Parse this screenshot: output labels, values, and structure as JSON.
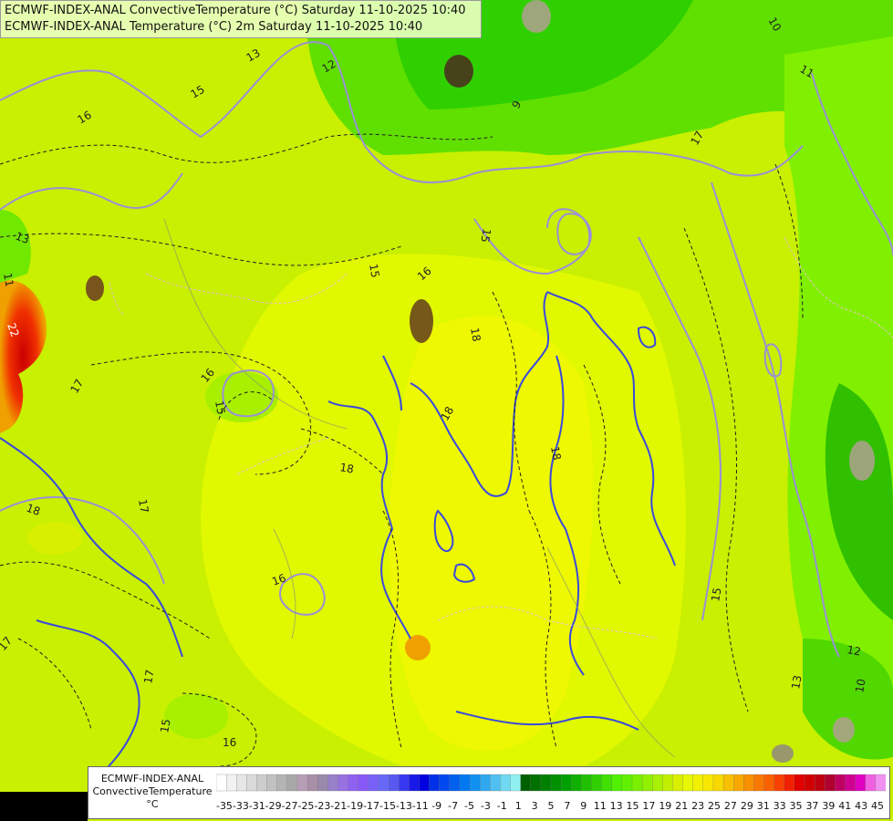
{
  "title": {
    "line1": "ECMWF-INDEX-ANAL ConvectiveTemperature (°C) Saturday 11-10-2025 10:40",
    "line2": "ECMWF-INDEX-ANAL Temperature (°C) 2m Saturday 11-10-2025 10:40"
  },
  "legend": {
    "line1": "ECMWF-INDEX-ANAL",
    "line2": "ConvectiveTemperature",
    "unit": "°C",
    "tick_labels": [
      "-35",
      "-33",
      "-31",
      "-29",
      "-27",
      "-25",
      "-23",
      "-21",
      "-19",
      "-17",
      "-15",
      "-13",
      "-11",
      "-9",
      "-7",
      "-5",
      "-3",
      "-1",
      "1",
      "3",
      "5",
      "7",
      "9",
      "11",
      "13",
      "15",
      "17",
      "19",
      "21",
      "23",
      "25",
      "27",
      "29",
      "31",
      "33",
      "35",
      "37",
      "39",
      "41",
      "43",
      "45"
    ],
    "colors": [
      "#ffffff",
      "#f2f2f2",
      "#e6e6e6",
      "#dadada",
      "#cdcdcd",
      "#c1c1c1",
      "#b4b4b4",
      "#a8a8a8",
      "#b79eb7",
      "#a890a8",
      "#9a8aaa",
      "#9880c8",
      "#9870e0",
      "#9060f0",
      "#8858f8",
      "#7860f8",
      "#6868f8",
      "#5858f0",
      "#3838f0",
      "#1818e8",
      "#0000e0",
      "#0030e8",
      "#0048f0",
      "#0060f0",
      "#0078f0",
      "#1090f0",
      "#30a8f0",
      "#50c0f0",
      "#70d8f0",
      "#90f0f0",
      "#006000",
      "#007000",
      "#008000",
      "#009000",
      "#00a000",
      "#10b000",
      "#20c000",
      "#30d000",
      "#40e000",
      "#50f000",
      "#60f000",
      "#78f000",
      "#90f000",
      "#a8f000",
      "#c0f000",
      "#d8f000",
      "#e8f800",
      "#f0f000",
      "#f8e800",
      "#f8d800",
      "#f8c000",
      "#f8a800",
      "#f89000",
      "#f87800",
      "#f86000",
      "#f84000",
      "#f02000",
      "#e00000",
      "#d00000",
      "#c00010",
      "#b00030",
      "#c00060",
      "#d00090",
      "#e000c0",
      "#f060e0",
      "#f090f0"
    ]
  },
  "map": {
    "contour_labels": [
      "13",
      "12",
      "10",
      "11",
      "9",
      "15",
      "16",
      "13",
      "11",
      "15",
      "16",
      "15",
      "18",
      "17",
      "15",
      "16",
      "18",
      "17",
      "18",
      "16",
      "17",
      "15",
      "16",
      "17",
      "18",
      "15",
      "13",
      "12",
      "10",
      "18",
      "17",
      "22"
    ]
  }
}
